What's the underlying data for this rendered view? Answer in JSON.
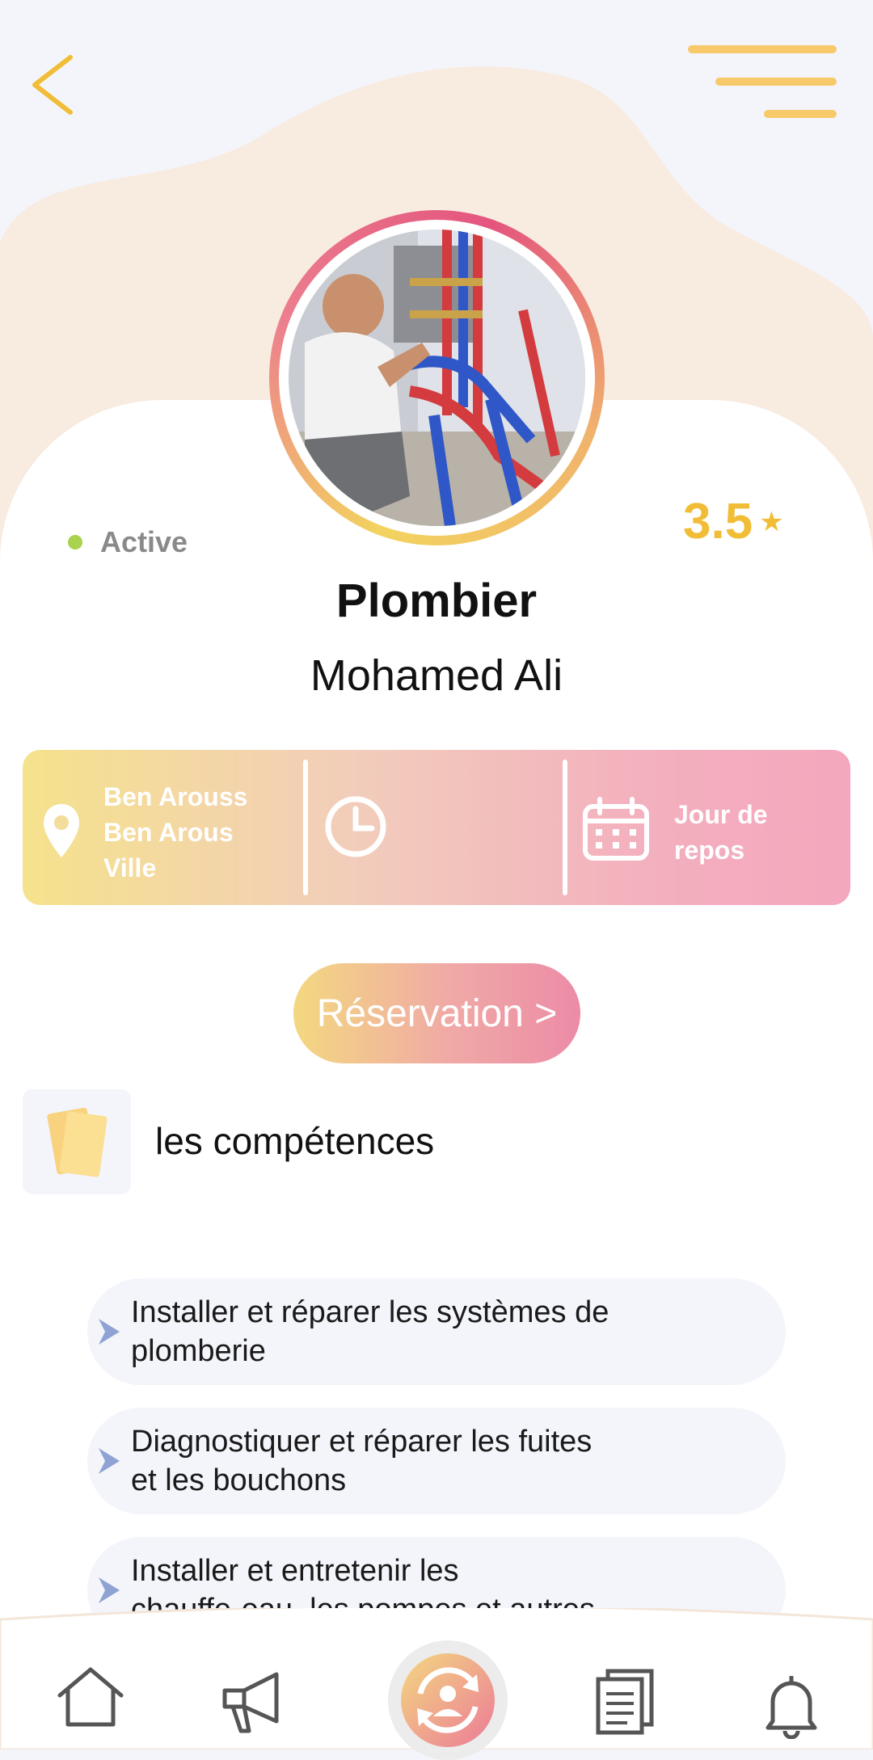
{
  "profile": {
    "status": "Active",
    "rating": "3.5",
    "rating_icon": "star-icon",
    "title": "Plombier",
    "name": "Mohamed Ali"
  },
  "info": {
    "location_lines": [
      "Ben Arouss",
      "Ben Arous",
      "Ville"
    ],
    "schedule_icon": "clock-icon",
    "day_off_lines": [
      "Jour de",
      "repos"
    ]
  },
  "reservation": {
    "label": "Réservation >"
  },
  "skills": {
    "heading": "les compétences",
    "items": [
      {
        "lines": [
          "Installer et réparer les systèmes de",
          "plomberie"
        ]
      },
      {
        "lines": [
          "Diagnostiquer et réparer les fuites",
          "et les bouchons"
        ]
      },
      {
        "lines": [
          "Installer et entretenir les",
          "chauffe-eau, les pompes et autres"
        ]
      }
    ]
  },
  "nav": {
    "items": [
      "home-icon",
      "megaphone-icon",
      "swap-user-icon",
      "documents-icon",
      "bell-icon"
    ]
  },
  "colors": {
    "accent_yellow": "#f1bd36",
    "status_green": "#a9d24e",
    "blob_peach": "#f8ebe0",
    "skill_arrow": "#8ea3d3"
  }
}
